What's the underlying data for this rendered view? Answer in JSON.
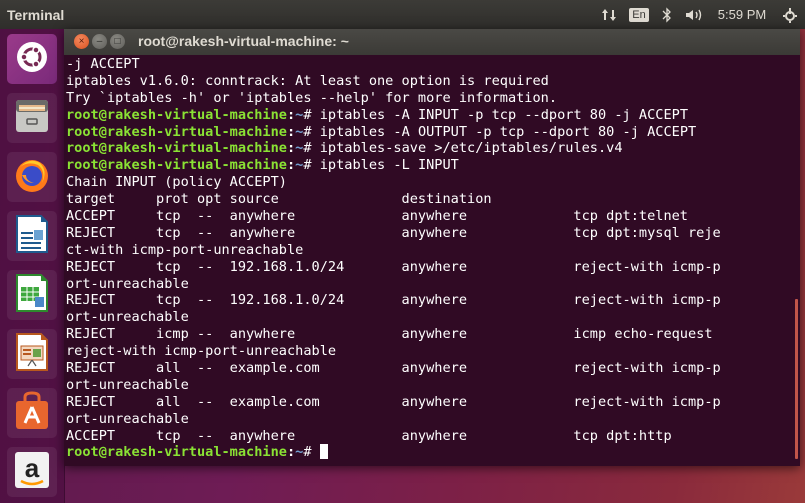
{
  "topbar": {
    "app_title": "Terminal",
    "tray": {
      "network_icon": "network-updown-icon",
      "language": "En",
      "bluetooth_icon": "bluetooth-icon",
      "volume_icon": "volume-icon",
      "clock": "5:59 PM",
      "settings_icon": "gear-icon"
    }
  },
  "launcher": {
    "items": [
      {
        "name": "Ubuntu Dash",
        "icon": "ubuntu-logo-icon"
      },
      {
        "name": "Files",
        "icon": "file-cabinet-icon"
      },
      {
        "name": "Firefox",
        "icon": "firefox-icon"
      },
      {
        "name": "LibreOffice Writer",
        "icon": "writer-document-icon"
      },
      {
        "name": "LibreOffice Calc",
        "icon": "calc-spreadsheet-icon"
      },
      {
        "name": "LibreOffice Impress",
        "icon": "impress-presentation-icon"
      },
      {
        "name": "Ubuntu Software",
        "icon": "shopping-bag-icon"
      },
      {
        "name": "Amazon",
        "icon": "amazon-icon"
      }
    ]
  },
  "window": {
    "title": "root@rakesh-virtual-machine: ~",
    "colors": {
      "background": "#300a24",
      "prompt_user": "#8ae234",
      "prompt_path": "#729fcf",
      "text": "#ffffff"
    }
  },
  "terminal": {
    "prompt": {
      "user_host": "root@rakesh-virtual-machine",
      "sep": ":",
      "path": "~",
      "symbol": "# "
    },
    "lines": [
      {
        "type": "out",
        "text": "-j ACCEPT"
      },
      {
        "type": "out",
        "text": "iptables v1.6.0: conntrack: At least one option is required"
      },
      {
        "type": "out",
        "text": "Try `iptables -h' or 'iptables --help' for more information."
      },
      {
        "type": "cmd",
        "text": "iptables -A INPUT -p tcp --dport 80 -j ACCEPT"
      },
      {
        "type": "cmd",
        "text": "iptables -A OUTPUT -p tcp --dport 80 -j ACCEPT"
      },
      {
        "type": "cmd",
        "text": "iptables-save >/etc/iptables/rules.v4"
      },
      {
        "type": "cmd",
        "text": "iptables -L INPUT"
      },
      {
        "type": "out",
        "text": "Chain INPUT (policy ACCEPT)"
      },
      {
        "type": "out",
        "text": "target     prot opt source               destination"
      },
      {
        "type": "out",
        "text": "ACCEPT     tcp  --  anywhere             anywhere             tcp dpt:telnet"
      },
      {
        "type": "out",
        "text": "REJECT     tcp  --  anywhere             anywhere             tcp dpt:mysql reje"
      },
      {
        "type": "out",
        "text": "ct-with icmp-port-unreachable"
      },
      {
        "type": "out",
        "text": "REJECT     tcp  --  192.168.1.0/24       anywhere             reject-with icmp-p"
      },
      {
        "type": "out",
        "text": "ort-unreachable"
      },
      {
        "type": "out",
        "text": "REJECT     tcp  --  192.168.1.0/24       anywhere             reject-with icmp-p"
      },
      {
        "type": "out",
        "text": "ort-unreachable"
      },
      {
        "type": "out",
        "text": "REJECT     icmp --  anywhere             anywhere             icmp echo-request"
      },
      {
        "type": "out",
        "text": "reject-with icmp-port-unreachable"
      },
      {
        "type": "out",
        "text": "REJECT     all  --  example.com          anywhere             reject-with icmp-p"
      },
      {
        "type": "out",
        "text": "ort-unreachable"
      },
      {
        "type": "out",
        "text": "REJECT     all  --  example.com          anywhere             reject-with icmp-p"
      },
      {
        "type": "out",
        "text": "ort-unreachable"
      },
      {
        "type": "out",
        "text": "ACCEPT     tcp  --  anywhere             anywhere             tcp dpt:http"
      },
      {
        "type": "prompt_cursor",
        "text": ""
      }
    ]
  }
}
